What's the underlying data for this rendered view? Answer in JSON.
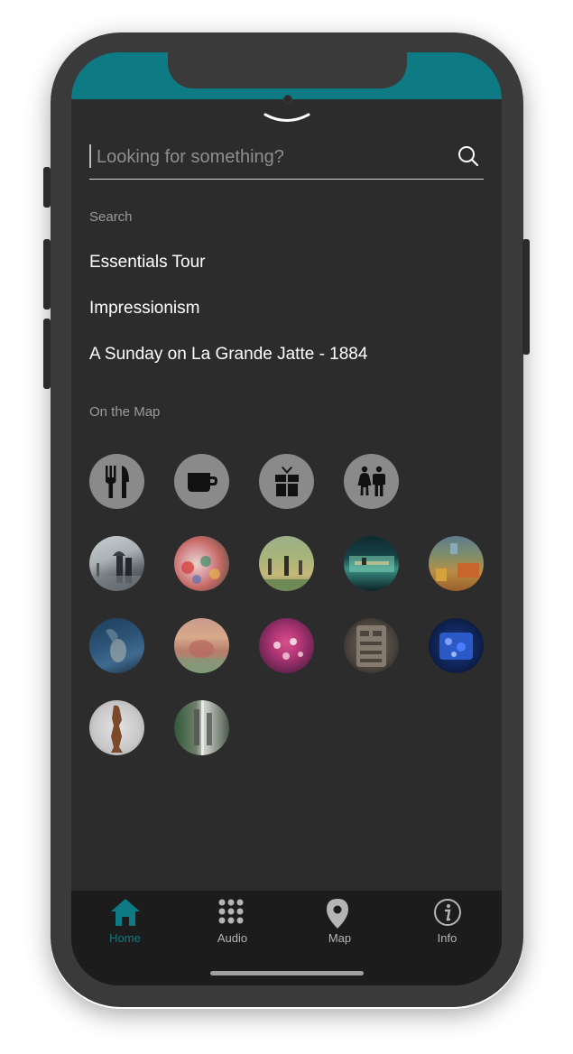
{
  "colors": {
    "accent": "#0e7a83",
    "background": "#2c2c2c",
    "tabbar": "#1c1c1c",
    "amenity_circle": "#8a8a8a"
  },
  "search": {
    "placeholder": "Looking for something?"
  },
  "sections": {
    "search_label": "Search",
    "map_label": "On the Map"
  },
  "suggestions": [
    {
      "label": "Essentials Tour"
    },
    {
      "label": "Impressionism"
    },
    {
      "label": "A Sunday on La Grande Jatte - 1884"
    }
  ],
  "amenities": [
    {
      "icon": "restaurant-icon"
    },
    {
      "icon": "coffee-icon"
    },
    {
      "icon": "gift-shop-icon"
    },
    {
      "icon": "restrooms-icon"
    }
  ],
  "artworks": [
    {
      "icon": "artwork-thumbnail",
      "palette": "rainy-street"
    },
    {
      "icon": "artwork-thumbnail",
      "palette": "colorful-crowd"
    },
    {
      "icon": "artwork-thumbnail",
      "palette": "park-scene"
    },
    {
      "icon": "artwork-thumbnail",
      "palette": "night-diner"
    },
    {
      "icon": "artwork-thumbnail",
      "palette": "bedroom"
    },
    {
      "icon": "artwork-thumbnail",
      "palette": "blue-guitarist"
    },
    {
      "icon": "artwork-thumbnail",
      "palette": "haystack"
    },
    {
      "icon": "artwork-thumbnail",
      "palette": "dancers"
    },
    {
      "icon": "artwork-thumbnail",
      "palette": "stone-tablet"
    },
    {
      "icon": "artwork-thumbnail",
      "palette": "blue-glass"
    },
    {
      "icon": "artwork-thumbnail",
      "palette": "wood-sculpture"
    },
    {
      "icon": "artwork-thumbnail",
      "palette": "figures-window"
    }
  ],
  "tabs": [
    {
      "label": "Home",
      "icon": "home-icon",
      "active": true
    },
    {
      "label": "Audio",
      "icon": "keypad-icon",
      "active": false
    },
    {
      "label": "Map",
      "icon": "map-pin-icon",
      "active": false
    },
    {
      "label": "Info",
      "icon": "info-icon",
      "active": false
    }
  ]
}
